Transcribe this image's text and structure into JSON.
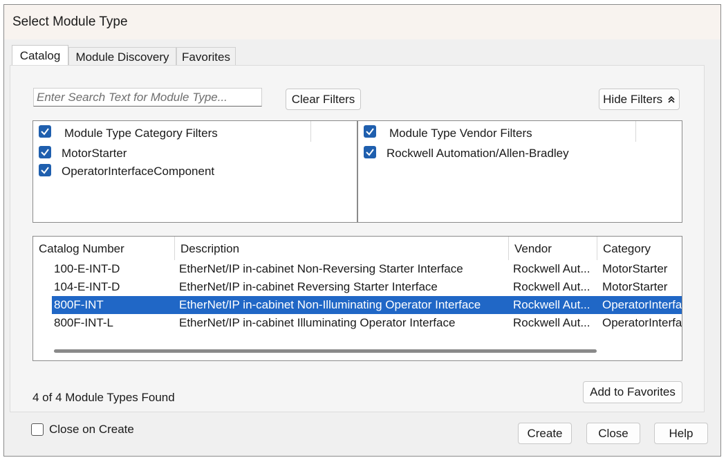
{
  "window": {
    "title": "Select Module Type"
  },
  "tabs": [
    {
      "label": "Catalog",
      "active": true
    },
    {
      "label": "Module Discovery",
      "active": false
    },
    {
      "label": "Favorites",
      "active": false
    }
  ],
  "search": {
    "placeholder": "Enter Search Text for Module Type...",
    "value": ""
  },
  "buttons": {
    "clear_filters": "Clear Filters",
    "hide_filters": "Hide Filters",
    "add_to_favorites": "Add to Favorites",
    "create": "Create",
    "close": "Close",
    "help": "Help"
  },
  "category_filters": {
    "header": "Module Type Category Filters",
    "header_checked": true,
    "items": [
      {
        "label": "MotorStarter",
        "checked": true
      },
      {
        "label": "OperatorInterfaceComponent",
        "checked": true
      }
    ]
  },
  "vendor_filters": {
    "header": "Module Type Vendor Filters",
    "header_checked": true,
    "items": [
      {
        "label": "Rockwell Automation/Allen-Bradley",
        "checked": true
      }
    ]
  },
  "table": {
    "columns": [
      "Catalog Number",
      "Description",
      "Vendor",
      "Category"
    ],
    "rows": [
      [
        "100-E-INT-D",
        "EtherNet/IP in-cabinet Non-Reversing Starter Interface",
        "Rockwell Aut...",
        "MotorStarter"
      ],
      [
        "104-E-INT-D",
        "EtherNet/IP in-cabinet Reversing Starter Interface",
        "Rockwell Aut...",
        "MotorStarter"
      ],
      [
        "800F-INT",
        "EtherNet/IP in-cabinet Non-Illuminating Operator Interface",
        "Rockwell Aut...",
        "OperatorInterfa"
      ],
      [
        "800F-INT-L",
        "EtherNet/IP in-cabinet Illuminating Operator Interface",
        "Rockwell Aut...",
        "OperatorInterfa"
      ]
    ],
    "selected_row": 2
  },
  "status": {
    "found_text": "4 of 4 Module Types Found"
  },
  "close_on_create": {
    "label": "Close on Create",
    "checked": false
  },
  "colors": {
    "accent": "#1f5fae",
    "selection": "#2067c6"
  }
}
